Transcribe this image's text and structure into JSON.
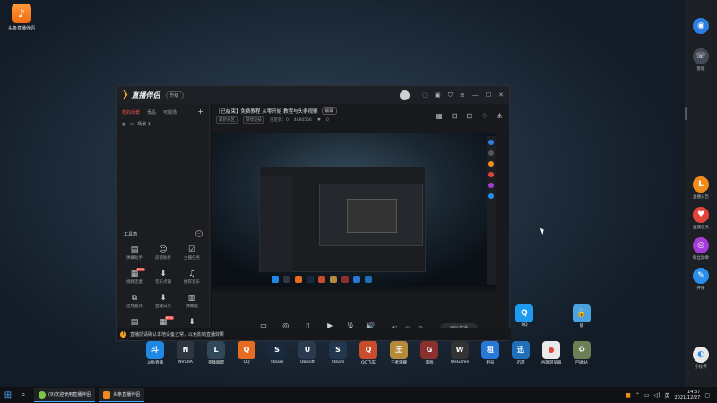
{
  "desktop": {
    "top_icon": {
      "label": "头条直播伴侣",
      "glyph": "♪"
    },
    "dock": [
      {
        "label": "斗鱼直播",
        "color": "#1e88e5",
        "glyph": "斗"
      },
      {
        "label": "NVIDIA",
        "color": "#2f3640",
        "glyph": "N"
      },
      {
        "label": "英雄联盟",
        "color": "#31485a",
        "glyph": "L"
      },
      {
        "label": "QQ",
        "color": "#e86b22",
        "glyph": "Q"
      },
      {
        "label": "Steam",
        "color": "#1a2a3e",
        "glyph": "S"
      },
      {
        "label": "Ubisoft",
        "color": "#2a3b4f",
        "glyph": "U"
      },
      {
        "label": "Steam",
        "color": "#22364e",
        "glyph": "S"
      },
      {
        "label": "QQ飞车",
        "color": "#c94c2b",
        "glyph": "Q"
      },
      {
        "label": "王者荣耀",
        "color": "#b58a3a",
        "glyph": "王"
      },
      {
        "label": "游戏",
        "color": "#8b2f2f",
        "glyph": "G"
      },
      {
        "label": "WeGame",
        "color": "#333333",
        "glyph": "W"
      },
      {
        "label": "租号",
        "color": "#2878d6",
        "glyph": "租"
      },
      {
        "label": "迅游",
        "color": "#1f6fb8",
        "glyph": "迅"
      },
      {
        "label": "谷歌浏览器",
        "color": "#e9e9e9",
        "glyph": "●"
      }
    ],
    "right_icons": [
      {
        "label": "QQ",
        "color": "#1d9bf0",
        "glyph": "Q"
      },
      {
        "label": "锁",
        "color": "#4aa3e0",
        "glyph": "🔒"
      },
      {
        "label": "回收站",
        "color": "#6b7f55",
        "glyph": "♻"
      }
    ]
  },
  "sidebar": [
    {
      "label": "",
      "color": "#2b7fe0",
      "glyph": "◉"
    },
    {
      "label": "客服",
      "color": "#444a55",
      "glyph": "☏"
    },
    {
      "label": "直播公告",
      "color": "#f18c1c",
      "glyph": "L"
    },
    {
      "label": "直播任务",
      "color": "#e2443b",
      "glyph": "♥"
    },
    {
      "label": "粉丝勋章",
      "color": "#a63cd8",
      "glyph": "◎"
    },
    {
      "label": "开播",
      "color": "#2a8fe8",
      "glyph": "✎"
    },
    {
      "label": "小伙伴",
      "color": "#e9e9e9",
      "glyph": "◐"
    }
  ],
  "window": {
    "logo": "直播伴侣",
    "version": "升级",
    "left_tabs": [
      "我的场景",
      "贡品",
      "可观场"
    ],
    "scene_name": "场景 1",
    "tools_title": "工具箱",
    "tools": [
      {
        "label": "弹幕助手",
        "icon": "▤"
      },
      {
        "label": "房管助手",
        "icon": "☺"
      },
      {
        "label": "主播任务",
        "icon": "☑"
      },
      {
        "label": "视频连麦",
        "icon": "▦",
        "tag": "NEW"
      },
      {
        "label": "音乐点播",
        "icon": "⬇"
      },
      {
        "label": "推荐音乐",
        "icon": "♫"
      },
      {
        "label": "连线嘉宾",
        "icon": "⧉"
      },
      {
        "label": "直播日历",
        "icon": "⬇"
      },
      {
        "label": "弹幕墙",
        "icon": "▥"
      },
      {
        "label": "",
        "icon": "▤"
      },
      {
        "label": "",
        "icon": "▦",
        "tag": "NEW"
      },
      {
        "label": "",
        "icon": "⬇"
      }
    ],
    "room_title": "【已结束】免费教程 从零开始 教程与头条视频",
    "edit_label": "编辑",
    "meta": [
      "最新分区",
      "游戏竞技",
      "已签到：0",
      "4880556",
      "0"
    ],
    "controls": [
      {
        "label": "直播画面",
        "icon": "▭"
      },
      {
        "label": "摄像头",
        "icon": "◎"
      },
      {
        "label": "手机投屏",
        "icon": "▯"
      },
      {
        "label": "多媒体",
        "icon": "▶"
      },
      {
        "label": "麦克风",
        "icon": "🎙"
      },
      {
        "label": "扬声器",
        "icon": "🔊"
      }
    ],
    "start_label": "开始直播",
    "status_text": "直播前请确认本地设备正常，以免影响直播效果"
  },
  "taskbar": {
    "items": [
      {
        "label": "(9)欢迎使用直播伴侣",
        "color": "#7ac943"
      },
      {
        "label": "头条直播伴侣",
        "color": "#f28a1c"
      }
    ],
    "lang": "英",
    "time": "14:37",
    "date": "2021/12/27"
  }
}
